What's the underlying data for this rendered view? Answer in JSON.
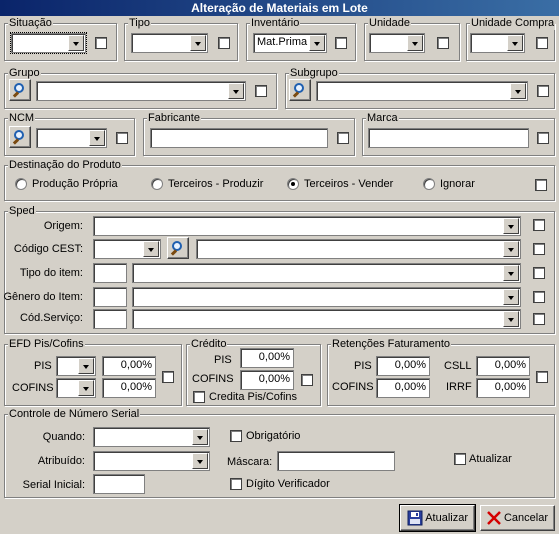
{
  "window": {
    "title": "Alteração de Materiais em Lote"
  },
  "top": {
    "situacao": {
      "label": "Situação",
      "value": ""
    },
    "tipo": {
      "label": "Tipo",
      "value": ""
    },
    "inventario": {
      "label": "Inventário",
      "value": "Mat.Prima"
    },
    "unidade": {
      "label": "Unidade",
      "value": ""
    },
    "unidade_compra": {
      "label": "Unidade Compra",
      "value": ""
    }
  },
  "grupo": {
    "label": "Grupo",
    "value": ""
  },
  "subgrupo": {
    "label": "Subgrupo",
    "value": ""
  },
  "ncm": {
    "label": "NCM",
    "value": ""
  },
  "fabricante": {
    "label": "Fabricante",
    "value": ""
  },
  "marca": {
    "label": "Marca",
    "value": ""
  },
  "destinacao": {
    "label": "Destinação do Produto",
    "options": [
      "Produção Própria",
      "Terceiros - Produzir",
      "Terceiros - Vender",
      "Ignorar"
    ],
    "selected": "Terceiros - Vender"
  },
  "sped": {
    "label": "Sped",
    "origem": {
      "label": "Origem:",
      "value": ""
    },
    "cest": {
      "label": "Código CEST:",
      "value": ""
    },
    "tipo_item": {
      "label": "Tipo do item:",
      "value": ""
    },
    "genero_item": {
      "label": "Gênero do Item:",
      "value": ""
    },
    "cod_servico": {
      "label": "Cód.Serviço:",
      "value": ""
    }
  },
  "efd": {
    "label": "EFD Pis/Cofins",
    "pis": {
      "label": "PIS",
      "value": "0,00%"
    },
    "cofins": {
      "label": "COFINS",
      "value": "0,00%"
    }
  },
  "credito": {
    "label": "Crédito",
    "pis": {
      "label": "PIS",
      "value": "0,00%"
    },
    "cofins": {
      "label": "COFINS",
      "value": "0,00%"
    },
    "credita": "Credita Pis/Cofins"
  },
  "retencoes": {
    "label": "Retenções Faturamento",
    "pis": {
      "label": "PIS",
      "value": "0,00%"
    },
    "cofins": {
      "label": "COFINS",
      "value": "0,00%"
    },
    "csll": {
      "label": "CSLL",
      "value": "0,00%"
    },
    "irrf": {
      "label": "IRRF",
      "value": "0,00%"
    }
  },
  "serial": {
    "label": "Controle de Número Serial",
    "quando": {
      "label": "Quando:",
      "value": ""
    },
    "atribuido": {
      "label": "Atribuído:",
      "value": ""
    },
    "inicial": {
      "label": "Serial Inicial:",
      "value": ""
    },
    "obrigatorio": "Obrigatório",
    "mascara": {
      "label": "Máscara:",
      "value": ""
    },
    "digito": "Dígito Verificador",
    "atualizar": "Atualizar"
  },
  "buttons": {
    "atualizar": "Atualizar",
    "cancelar": "Cancelar"
  },
  "colors": {
    "title_bar": "#0a246a",
    "face": "#d4d0c8",
    "cancel_x": "#d40000"
  }
}
